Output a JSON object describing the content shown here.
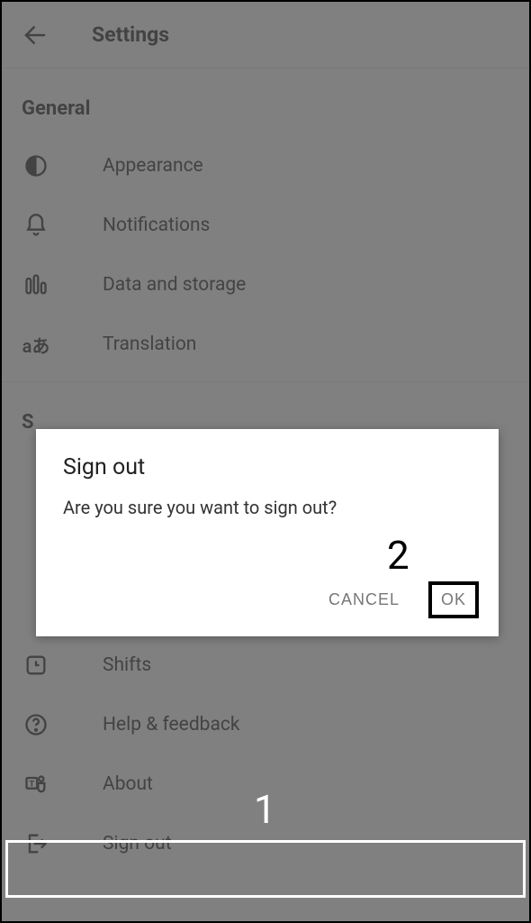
{
  "header": {
    "title": "Settings"
  },
  "general": {
    "header": "General",
    "items": [
      {
        "label": "Appearance"
      },
      {
        "label": "Notifications"
      },
      {
        "label": "Data and storage"
      },
      {
        "label": "Translation"
      }
    ]
  },
  "section2": {
    "header": "S",
    "items": [
      {
        "label": "Shifts"
      },
      {
        "label": "Help & feedback"
      },
      {
        "label": "About"
      },
      {
        "label": "Sign out"
      }
    ]
  },
  "dialog": {
    "title": "Sign out",
    "message": "Are you sure you want to sign out?",
    "cancel": "CANCEL",
    "ok": "OK"
  },
  "annotations": {
    "one": "1",
    "two": "2"
  }
}
